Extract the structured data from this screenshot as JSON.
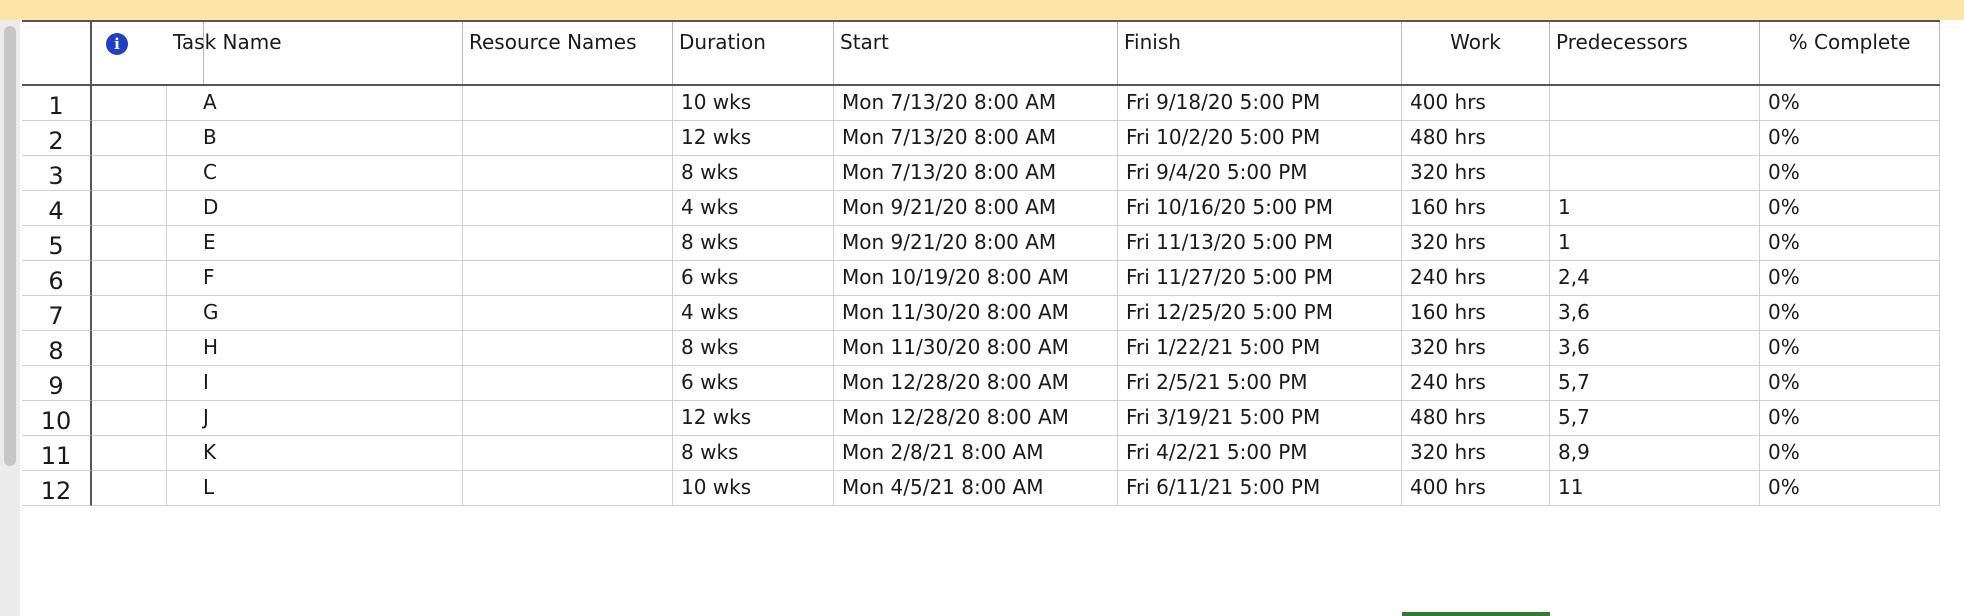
{
  "table": {
    "headers": {
      "indicator": "",
      "task_name": "Task Name",
      "resource_names": "Resource Names",
      "duration": "Duration",
      "start": "Start",
      "finish": "Finish",
      "work": "Work",
      "predecessors": "Predecessors",
      "percent_complete": "% Complete"
    },
    "rows": [
      {
        "id": "1",
        "name": "A",
        "resource": "",
        "duration": "10 wks",
        "start": "Mon 7/13/20 8:00 AM",
        "finish": "Fri 9/18/20 5:00 PM",
        "work": "400 hrs",
        "pred": "",
        "pct": "0%"
      },
      {
        "id": "2",
        "name": "B",
        "resource": "",
        "duration": "12 wks",
        "start": "Mon 7/13/20 8:00 AM",
        "finish": "Fri 10/2/20 5:00 PM",
        "work": "480 hrs",
        "pred": "",
        "pct": "0%"
      },
      {
        "id": "3",
        "name": "C",
        "resource": "",
        "duration": "8 wks",
        "start": "Mon 7/13/20 8:00 AM",
        "finish": "Fri 9/4/20 5:00 PM",
        "work": "320 hrs",
        "pred": "",
        "pct": "0%"
      },
      {
        "id": "4",
        "name": "D",
        "resource": "",
        "duration": "4 wks",
        "start": "Mon 9/21/20 8:00 AM",
        "finish": "Fri 10/16/20 5:00 PM",
        "work": "160 hrs",
        "pred": "1",
        "pct": "0%"
      },
      {
        "id": "5",
        "name": "E",
        "resource": "",
        "duration": "8 wks",
        "start": "Mon 9/21/20 8:00 AM",
        "finish": "Fri 11/13/20 5:00 PM",
        "work": "320 hrs",
        "pred": "1",
        "pct": "0%"
      },
      {
        "id": "6",
        "name": "F",
        "resource": "",
        "duration": "6 wks",
        "start": "Mon 10/19/20 8:00 AM",
        "finish": "Fri 11/27/20 5:00 PM",
        "work": "240 hrs",
        "pred": "2,4",
        "pct": "0%"
      },
      {
        "id": "7",
        "name": "G",
        "resource": "",
        "duration": "4 wks",
        "start": "Mon 11/30/20 8:00 AM",
        "finish": "Fri 12/25/20 5:00 PM",
        "work": "160 hrs",
        "pred": "3,6",
        "pct": "0%"
      },
      {
        "id": "8",
        "name": "H",
        "resource": "",
        "duration": "8 wks",
        "start": "Mon 11/30/20 8:00 AM",
        "finish": "Fri 1/22/21 5:00 PM",
        "work": "320 hrs",
        "pred": "3,6",
        "pct": "0%"
      },
      {
        "id": "9",
        "name": "I",
        "resource": "",
        "duration": "6 wks",
        "start": "Mon 12/28/20 8:00 AM",
        "finish": "Fri 2/5/21 5:00 PM",
        "work": "240 hrs",
        "pred": "5,7",
        "pct": "0%"
      },
      {
        "id": "10",
        "name": "J",
        "resource": "",
        "duration": "12 wks",
        "start": "Mon 12/28/20 8:00 AM",
        "finish": "Fri 3/19/21 5:00 PM",
        "work": "480 hrs",
        "pred": "5,7",
        "pct": "0%"
      },
      {
        "id": "11",
        "name": "K",
        "resource": "",
        "duration": "8 wks",
        "start": "Mon 2/8/21 8:00 AM",
        "finish": "Fri 4/2/21 5:00 PM",
        "work": "320 hrs",
        "pred": "8,9",
        "pct": "0%"
      },
      {
        "id": "12",
        "name": "L",
        "resource": "",
        "duration": "10 wks",
        "start": "Mon 4/5/21 8:00 AM",
        "finish": "Fri 6/11/21 5:00 PM",
        "work": "400 hrs",
        "pred": "11",
        "pct": "0%"
      }
    ]
  },
  "icons": {
    "indicator_header": "info-icon"
  },
  "colors": {
    "info_icon": "#1f3fc4",
    "top_band": "#fde5a8",
    "selection_accent": "#2e7d32"
  }
}
